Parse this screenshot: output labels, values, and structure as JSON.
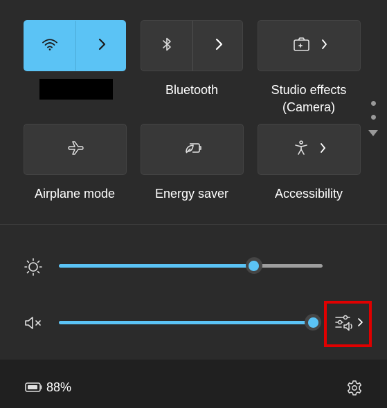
{
  "tiles": {
    "wifi": {
      "label": "",
      "active": true
    },
    "bluetooth": {
      "label": "Bluetooth",
      "active": false
    },
    "studio_effects": {
      "label_line1": "Studio effects",
      "label_line2": "(Camera)",
      "active": false
    },
    "airplane_mode": {
      "label": "Airplane mode",
      "active": false
    },
    "energy_saver": {
      "label": "Energy saver",
      "active": false
    },
    "accessibility": {
      "label": "Accessibility",
      "active": false
    }
  },
  "sliders": {
    "brightness": {
      "value": 0.74
    },
    "volume": {
      "value": 1.0,
      "muted": true
    }
  },
  "footer": {
    "battery_label": "88%"
  },
  "icons": {
    "wifi": "wifi-icon",
    "bluetooth": "bluetooth-icon",
    "studio_effects": "studio-effects-icon",
    "airplane": "airplane-icon",
    "energy_saver": "energy-saver-icon",
    "accessibility": "accessibility-icon",
    "brightness": "sun-icon",
    "volume": "speaker-muted-icon",
    "audio_output": "audio-output-icon",
    "battery": "battery-icon",
    "settings": "gear-icon"
  },
  "colors": {
    "accent": "#5bc3f5",
    "panel": "#2b2b2b",
    "tile": "#383838",
    "footer": "#202020",
    "highlight": "#e00000"
  }
}
